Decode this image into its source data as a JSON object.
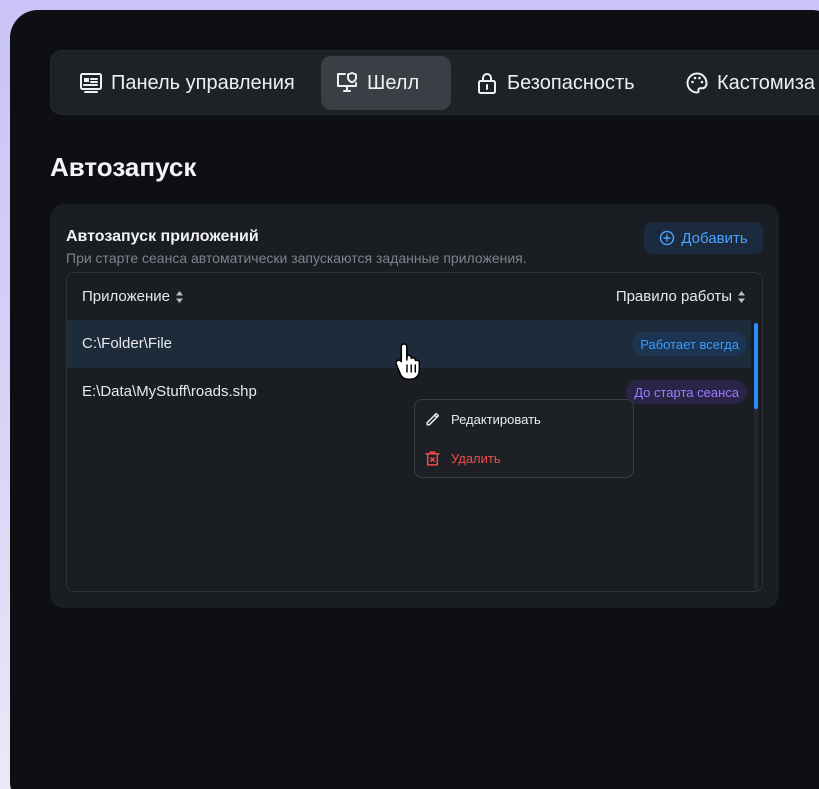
{
  "tabs": [
    {
      "label": "Панель управления",
      "icon": "dashboard-icon",
      "active": false
    },
    {
      "label": "Шелл",
      "icon": "monitor-shield-icon",
      "active": true
    },
    {
      "label": "Безопасность",
      "icon": "lock-icon",
      "active": false
    },
    {
      "label": "Кастомиза",
      "icon": "palette-icon",
      "active": false
    }
  ],
  "page": {
    "title": "Автозапуск"
  },
  "card": {
    "title": "Автозапуск приложений",
    "subtitle": "При старте сеанса автоматически запускаются заданные приложения.",
    "add_label": "Добавить"
  },
  "table": {
    "columns": {
      "app": "Приложение",
      "rule": "Правило работы"
    },
    "rows": [
      {
        "path": "C:\\Folder\\File",
        "rule": "Работает всегда",
        "rule_color": "#3e9bff"
      },
      {
        "path": "E:\\Data\\MyStuff\\roads.shp",
        "rule": "До старта сеанса",
        "rule_color": "#9d7cff"
      }
    ]
  },
  "context_menu": {
    "edit_label": "Редактировать",
    "delete_label": "Удалить"
  },
  "colors": {
    "accent": "#2f8cff",
    "danger": "#f04b4b",
    "background": "#0d0f12"
  }
}
